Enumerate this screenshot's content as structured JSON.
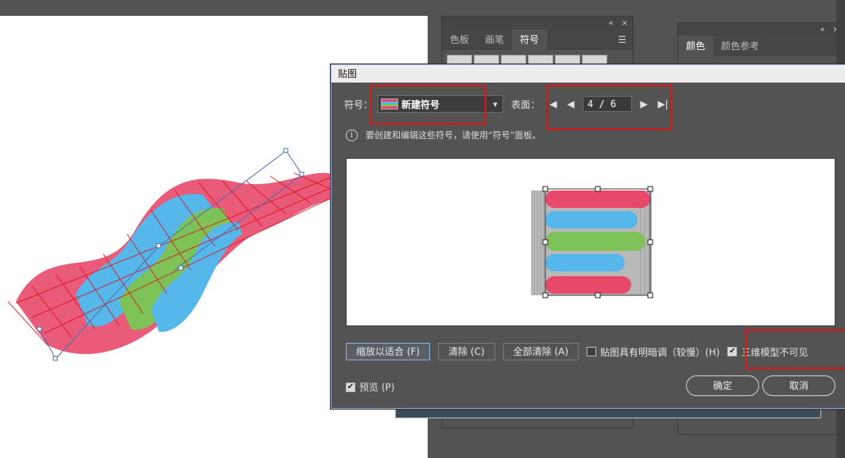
{
  "panels": {
    "symbols": {
      "tabs": [
        {
          "label": "色板",
          "active": false
        },
        {
          "label": "画笔",
          "active": false
        },
        {
          "label": "符号",
          "active": true
        }
      ],
      "top_controls": [
        "«",
        "×"
      ]
    },
    "color": {
      "tabs": [
        {
          "label": "颜色",
          "active": true
        },
        {
          "label": "颜色参考",
          "active": false
        }
      ],
      "top_controls": [
        "«",
        "×"
      ]
    }
  },
  "dialog": {
    "title": "贴图",
    "symbol_label": "符号：",
    "symbol_value": "新建符号",
    "surface_label": "表面：",
    "surface_value": "4 / 6",
    "info_text": "要创建和编辑这些符号，请使用“符号”面板。",
    "buttons": {
      "fit": "缩放以适合 (F)",
      "clear": "清除 (C)",
      "clear_all": "全部清除 (A)",
      "ok": "确定",
      "cancel": "取消"
    },
    "checkboxes": {
      "shade_label": "贴图具有明暗调（较慢）(H)",
      "shade_checked": false,
      "invisible_label": "三维模型不可见",
      "invisible_checked": true,
      "preview_label": "预览 (P)",
      "preview_checked": true
    }
  },
  "colors": {
    "stripe_red": "#e8486a",
    "stripe_blue": "#55b7ea",
    "stripe_green": "#7cc257",
    "highlight": "#e01414"
  }
}
